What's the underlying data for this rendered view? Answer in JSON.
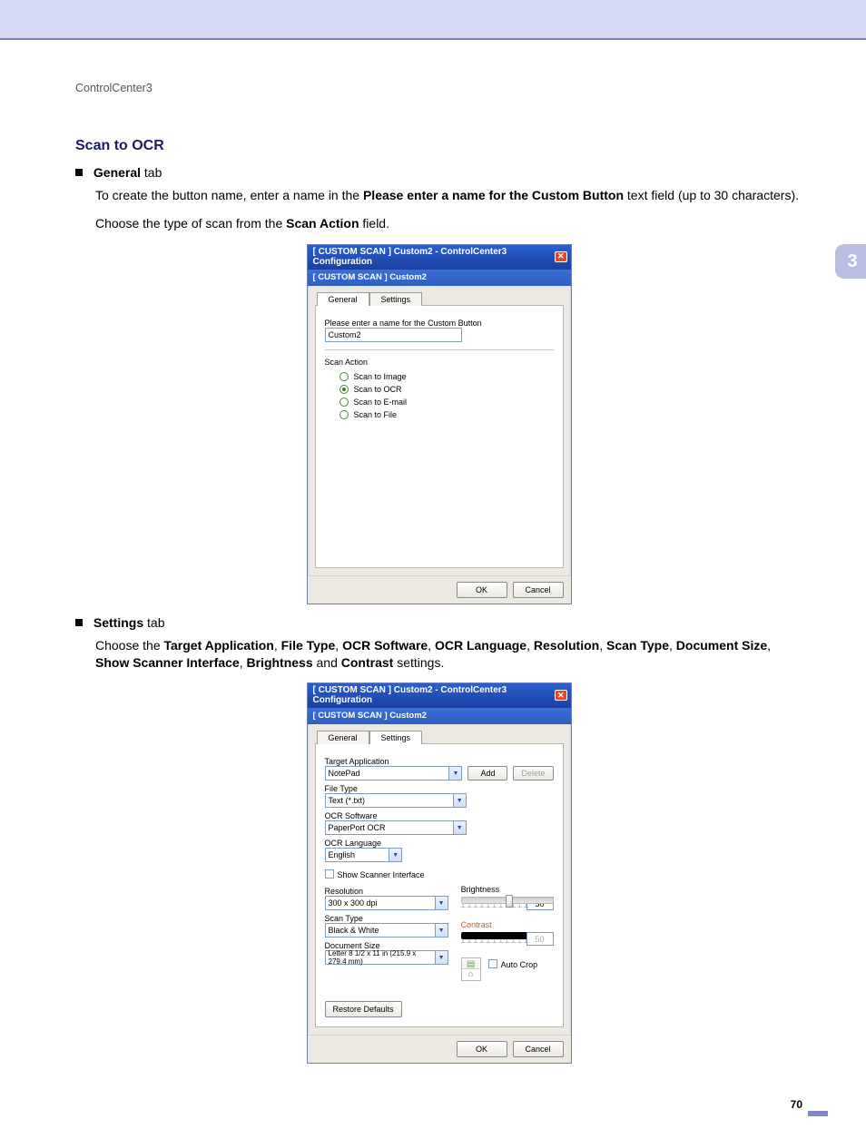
{
  "breadcrumb": "ControlCenter3",
  "section_title": "Scan to OCR",
  "bullet1": {
    "strong": "General",
    "rest": " tab"
  },
  "para1": {
    "pre": "To create the button name, enter a name in the ",
    "strong": "Please enter a name for the Custom Button",
    "post": " text field (up to 30 characters)."
  },
  "para2": {
    "pre": "Choose the type of scan from the ",
    "strong": "Scan Action",
    "post": " field."
  },
  "bullet2": {
    "strong": "Settings",
    "rest": " tab"
  },
  "para3": {
    "parts": [
      {
        "t": "Choose the "
      },
      {
        "b": "Target Application"
      },
      {
        "t": ", "
      },
      {
        "b": "File Type"
      },
      {
        "t": ", "
      },
      {
        "b": "OCR Software"
      },
      {
        "t": ", "
      },
      {
        "b": "OCR Language"
      },
      {
        "t": ", "
      },
      {
        "b": "Resolution"
      },
      {
        "t": ", "
      },
      {
        "b": "Scan Type"
      },
      {
        "t": ", "
      },
      {
        "b": "Document Size"
      },
      {
        "t": ", "
      },
      {
        "b": "Show Scanner Interface"
      },
      {
        "t": ", "
      },
      {
        "b": "Brightness"
      },
      {
        "t": " and "
      },
      {
        "b": "Contrast"
      },
      {
        "t": " settings."
      }
    ]
  },
  "chapter_marker": "3",
  "page_number": "70",
  "dialog1": {
    "titlebar": "[  CUSTOM SCAN  ]   Custom2 - ControlCenter3 Configuration",
    "subtitle": "[  CUSTOM SCAN  ]   Custom2",
    "tabs": {
      "general": "General",
      "settings": "Settings"
    },
    "label_enter_name": "Please enter a name for the Custom Button",
    "custom_name_value": "Custom2",
    "scan_action_label": "Scan Action",
    "radios": {
      "image": "Scan to Image",
      "ocr": "Scan to OCR",
      "email": "Scan to E-mail",
      "file": "Scan to File"
    },
    "ok": "OK",
    "cancel": "Cancel"
  },
  "dialog2": {
    "titlebar": "[  CUSTOM SCAN  ]   Custom2 - ControlCenter3 Configuration",
    "subtitle": "[  CUSTOM SCAN  ]   Custom2",
    "tabs": {
      "general": "General",
      "settings": "Settings"
    },
    "labels": {
      "target_app": "Target Application",
      "file_type": "File Type",
      "ocr_software": "OCR Software",
      "ocr_language": "OCR Language",
      "show_scanner": "Show Scanner Interface",
      "resolution": "Resolution",
      "scan_type": "Scan Type",
      "document_size": "Document Size",
      "brightness": "Brightness",
      "contrast": "Contrast",
      "auto_crop": "Auto Crop"
    },
    "values": {
      "target_app": "NotePad",
      "file_type": "Text (*.txt)",
      "ocr_software": "PaperPort OCR",
      "ocr_language": "English",
      "resolution": "300 x 300 dpi",
      "scan_type": "Black & White",
      "document_size": "Letter 8 1/2 x 11 in (215.9 x 279.4 mm)",
      "brightness": "50",
      "contrast": "50"
    },
    "buttons": {
      "add": "Add",
      "delete": "Delete",
      "restore": "Restore Defaults",
      "ok": "OK",
      "cancel": "Cancel"
    }
  }
}
